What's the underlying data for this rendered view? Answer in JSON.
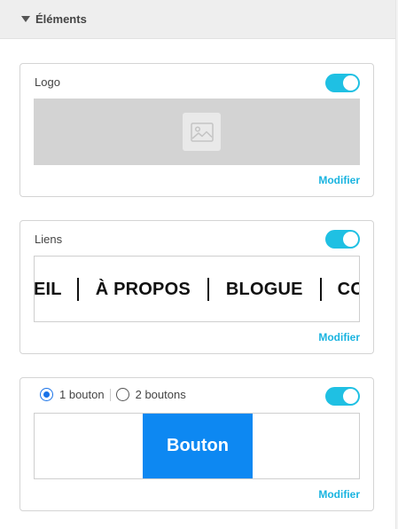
{
  "section": {
    "title": "Éléments",
    "expanded": true
  },
  "logo_card": {
    "label": "Logo",
    "enabled": true,
    "placeholder_icon": "image-placeholder-icon",
    "modify_label": "Modifier"
  },
  "links_card": {
    "label": "Liens",
    "enabled": true,
    "links": [
      "EIL",
      "À PROPOS",
      "BLOGUE",
      "CO"
    ],
    "modify_label": "Modifier"
  },
  "button_card": {
    "options": [
      {
        "label": "1 bouton",
        "selected": true
      },
      {
        "label": "2 boutons",
        "selected": false
      }
    ],
    "enabled": true,
    "button_label": "Bouton",
    "modify_label": "Modifier"
  },
  "colors": {
    "toggle_on": "#1fc0e3",
    "link_accent": "#1ab4e0",
    "button_primary": "#0d88f2",
    "radio_selected": "#1a73e8"
  }
}
